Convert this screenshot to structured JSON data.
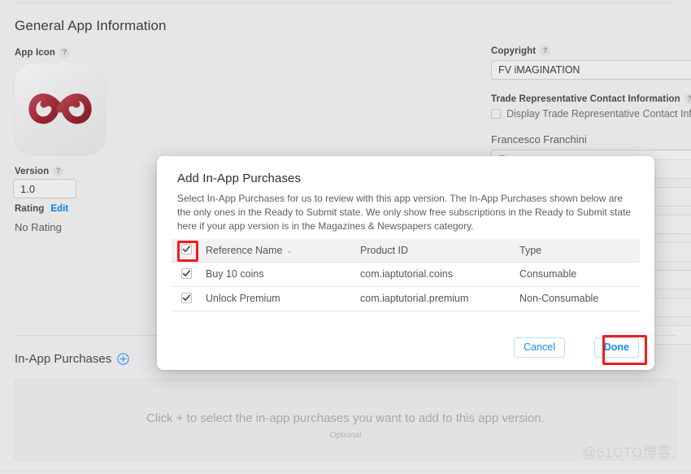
{
  "page": {
    "title": "General App Information",
    "watermark": "@51CTO博客"
  },
  "left": {
    "app_icon_label": "App Icon",
    "help_glyph": "?",
    "version_label": "Version",
    "version_value": "1.0",
    "rating_label": "Rating",
    "rating_edit": "Edit",
    "rating_value": "No Rating"
  },
  "right": {
    "copyright_label": "Copyright",
    "copyright_value": "FV iMAGINATION",
    "trade_label": "Trade Representative Contact Information",
    "trade_checkbox_text": "Display Trade Representative Contact Inform",
    "person_name": "Francesco Franchini",
    "first_name_placeholder": "First name"
  },
  "modal": {
    "title": "Add In-App Purchases",
    "description": "Select In-App Purchases for us to review with this app version. The In-App Purchases shown below are the only ones in the Ready to Submit state. We only show free subscriptions in the Ready to Submit state here if your app version is in the Magazines & Newspapers category.",
    "table": {
      "headers": [
        "Reference Name",
        "Product ID",
        "Type"
      ],
      "sort_caret": "⌄",
      "header_checked": true,
      "rows": [
        {
          "checked": true,
          "name": "Buy 10 coins",
          "product_id": "com.iaptutorial.coins",
          "type": "Consumable"
        },
        {
          "checked": true,
          "name": "Unlock Premium",
          "product_id": "com.iaptutorial.premium",
          "type": "Non-Consumable"
        }
      ]
    },
    "cancel_label": "Cancel",
    "done_label": "Done"
  },
  "iap_section": {
    "heading": "In-App Purchases",
    "dropzone_main": "Click + to select the in-app purchases you want to add to this app version.",
    "dropzone_sub": "Optional"
  },
  "colors": {
    "accent_blue": "#1789f5",
    "link_blue": "#0a7cf0",
    "highlight_red": "#f01c1c",
    "page_bg": "#e6e6e6",
    "modal_bg": "#ffffff",
    "icon_red": "#9e2a35"
  }
}
